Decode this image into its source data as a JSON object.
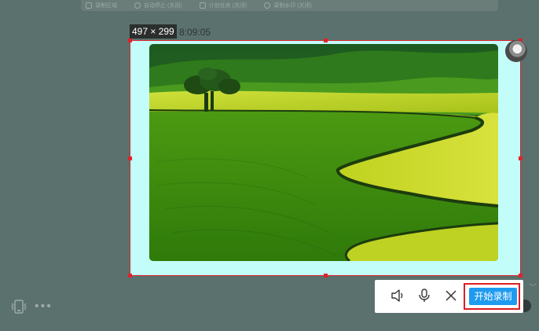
{
  "top_toolbar": {
    "items": [
      {
        "label": "录制区域"
      },
      {
        "label": "自动停止 (关闭)"
      },
      {
        "label": "计划任务 (关闭)"
      },
      {
        "label": "录制水印 (关闭)"
      }
    ]
  },
  "selection": {
    "size_label": "497 × 299",
    "timestamp": "8:09:05"
  },
  "recording_toolbar": {
    "speaker_icon": "speaker-icon",
    "mic_icon": "microphone-icon",
    "close_icon": "close-icon",
    "start_label": "开始录制"
  },
  "colors": {
    "selection_border": "#e0222b",
    "selection_fill": "#c2fdf9",
    "start_button": "#1e9bf0",
    "overlay": "#5b716d"
  }
}
